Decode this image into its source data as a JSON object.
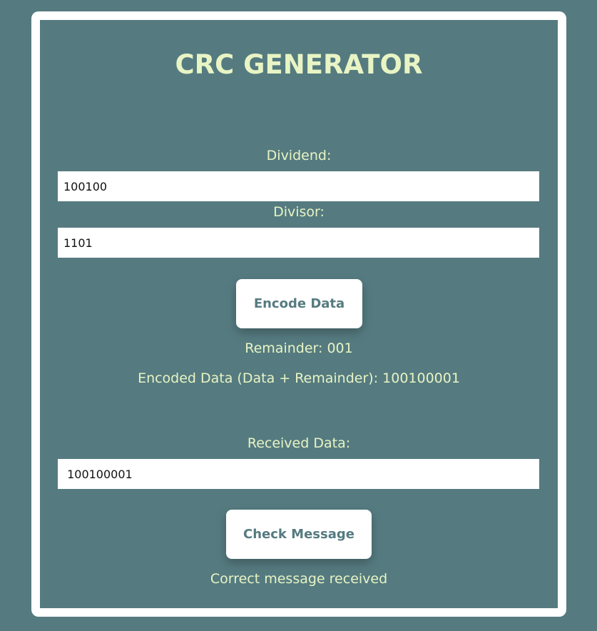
{
  "app": {
    "title": "CRC GENERATOR"
  },
  "encoder": {
    "dividend_label": "Dividend:",
    "dividend_value": "100100",
    "divisor_label": "Divisor:",
    "divisor_value": "1101",
    "encode_button": "Encode Data",
    "remainder_text": "Remainder: 001",
    "encoded_text": "Encoded Data (Data + Remainder): 100100001"
  },
  "checker": {
    "received_label": "Received Data:",
    "received_value": " 100100001",
    "check_button": "Check Message",
    "result_text": "Correct message received"
  },
  "colors": {
    "background": "#557b80",
    "accent_text": "#e8f4c4",
    "frame": "#ffffff"
  }
}
